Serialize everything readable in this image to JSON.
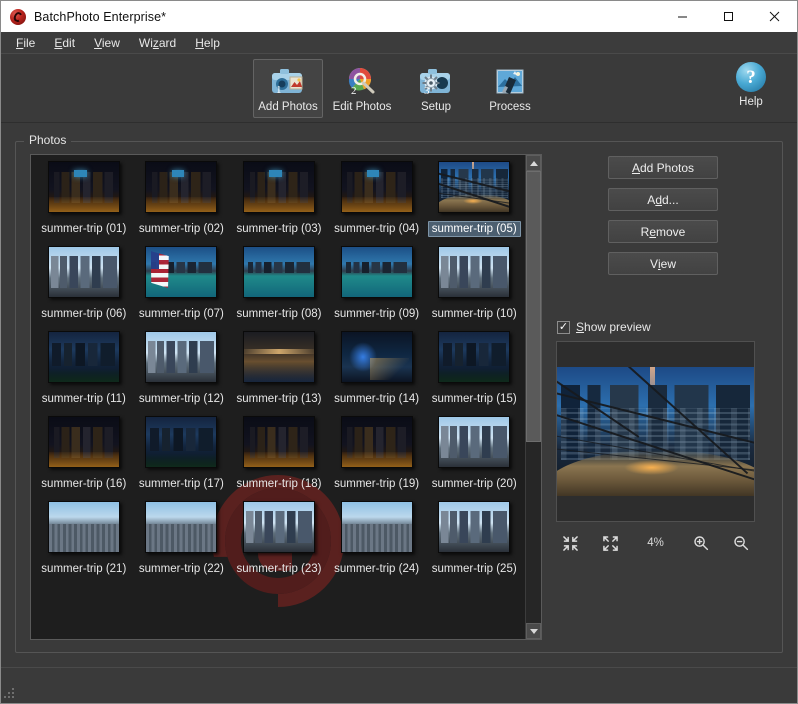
{
  "window": {
    "title": "BatchPhoto Enterprise*",
    "app_icon": "batchphoto-logo-icon",
    "minimize_label": "Minimize",
    "maximize_label": "Maximize",
    "close_label": "Close"
  },
  "menubar": {
    "items": [
      {
        "label": "File",
        "mnemonic": "F"
      },
      {
        "label": "Edit",
        "mnemonic": "E"
      },
      {
        "label": "View",
        "mnemonic": "V"
      },
      {
        "label": "Wizard",
        "mnemonic": "z"
      },
      {
        "label": "Help",
        "mnemonic": "H"
      }
    ]
  },
  "toolbar": {
    "buttons": [
      {
        "label": "Add Photos",
        "step": "1",
        "icon": "add-photos-icon",
        "active": true
      },
      {
        "label": "Edit Photos",
        "step": "2",
        "icon": "edit-photos-icon",
        "active": false
      },
      {
        "label": "Setup",
        "step": "3",
        "icon": "setup-icon",
        "active": false
      },
      {
        "label": "Process",
        "step": "",
        "icon": "process-icon",
        "active": false
      }
    ],
    "help": {
      "label": "Help",
      "glyph": "?",
      "icon": "help-icon"
    }
  },
  "photos_group": {
    "title": "Photos",
    "selected_index": 4,
    "thumbnails": [
      {
        "label": "summer-trip (01)",
        "style": "ph-night",
        "sign": true
      },
      {
        "label": "summer-trip (02)",
        "style": "ph-night",
        "sign": true
      },
      {
        "label": "summer-trip (03)",
        "style": "ph-night",
        "sign": true
      },
      {
        "label": "summer-trip (04)",
        "style": "ph-night",
        "sign": true
      },
      {
        "label": "summer-trip (05)",
        "style": "ph-pavilion",
        "sign": false
      },
      {
        "label": "summer-trip (06)",
        "style": "ph-day",
        "sign": false
      },
      {
        "label": "summer-trip (07)",
        "style": "ph-lake",
        "sign": false
      },
      {
        "label": "summer-trip (08)",
        "style": "ph-lake",
        "sign": false
      },
      {
        "label": "summer-trip (09)",
        "style": "ph-lake",
        "sign": false
      },
      {
        "label": "summer-trip (10)",
        "style": "ph-day",
        "sign": false
      },
      {
        "label": "summer-trip (11)",
        "style": "ph-dusk",
        "sign": false
      },
      {
        "label": "summer-trip (12)",
        "style": "ph-day",
        "sign": false
      },
      {
        "label": "summer-trip (13)",
        "style": "ph-interior",
        "sign": false
      },
      {
        "label": "summer-trip (14)",
        "style": "ph-blue",
        "sign": false
      },
      {
        "label": "summer-trip (15)",
        "style": "ph-dusk",
        "sign": false
      },
      {
        "label": "summer-trip (16)",
        "style": "ph-night",
        "sign": false
      },
      {
        "label": "summer-trip (17)",
        "style": "ph-dusk",
        "sign": false
      },
      {
        "label": "summer-trip (18)",
        "style": "ph-night",
        "sign": false
      },
      {
        "label": "summer-trip (19)",
        "style": "ph-night",
        "sign": false
      },
      {
        "label": "summer-trip (20)",
        "style": "ph-day",
        "sign": false
      },
      {
        "label": "summer-trip (21)",
        "style": "ph-aerial",
        "sign": false
      },
      {
        "label": "summer-trip (22)",
        "style": "ph-aerial",
        "sign": false
      },
      {
        "label": "summer-trip (23)",
        "style": "ph-day",
        "sign": false
      },
      {
        "label": "summer-trip (24)",
        "style": "ph-aerial",
        "sign": false
      },
      {
        "label": "summer-trip (25)",
        "style": "ph-day",
        "sign": false
      }
    ],
    "scrollbar": {
      "up_icon": "scroll-up-arrow-icon",
      "down_icon": "scroll-down-arrow-icon",
      "thumb_top_pct": 0,
      "thumb_height_pct": 60
    },
    "watermark": "batchphoto-watermark-logo"
  },
  "side_actions": {
    "buttons": [
      {
        "label": "Add Photos",
        "mnemonic": "A",
        "name": "add-photos-button"
      },
      {
        "label": "Add...",
        "mnemonic": "d",
        "name": "add-button"
      },
      {
        "label": "Remove",
        "mnemonic": "e",
        "name": "remove-button"
      },
      {
        "label": "View",
        "mnemonic": "i",
        "name": "view-button"
      }
    ]
  },
  "preview": {
    "checkbox": {
      "label": "Show preview",
      "mnemonic": "S",
      "checked": true,
      "check_glyph": "✓"
    },
    "image_alt": "summer-trip (05) preview",
    "zoom": {
      "percent": "4%",
      "fit_in_icon": "fit-in-icon",
      "fit_out_icon": "fit-out-icon",
      "zoom_in_icon": "zoom-in-icon",
      "zoom_out_icon": "zoom-out-icon"
    }
  },
  "statusbar": {
    "text": "",
    "grip_icon": "resize-grip-icon"
  },
  "colors": {
    "window_bg": "#3a3a3a",
    "titlebar_bg": "#ffffff",
    "grid_bg": "#1e1e1e",
    "selection_bg": "#4c5f70",
    "selection_border": "#7e95a8",
    "accent_red": "#b7221c",
    "help_blue": "#4aaad4"
  }
}
